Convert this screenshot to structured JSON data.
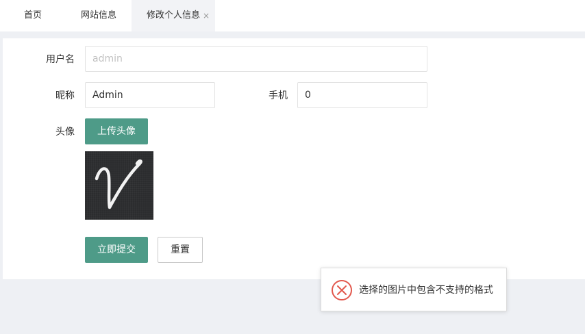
{
  "tabs": [
    {
      "label": "首页"
    },
    {
      "label": "网站信息"
    },
    {
      "label": "修改个人信息",
      "close": "×",
      "active": true
    }
  ],
  "form": {
    "username_label": "用户名",
    "username_placeholder": "admin",
    "nickname_label": "昵称",
    "nickname_value": "Admin",
    "phone_label": "手机",
    "phone_value": "0",
    "avatar_label": "头像",
    "upload_button": "上传头像",
    "avatar_icon": "cursive-v-avatar-image",
    "submit_button": "立即提交",
    "reset_button": "重置"
  },
  "toast": {
    "message": "选择的图片中包含不支持的格式",
    "icon": "error-circle-x-icon",
    "icon_color": "#e2574c"
  },
  "colors": {
    "accent": "#4e9b88",
    "background": "#eef0f4"
  }
}
